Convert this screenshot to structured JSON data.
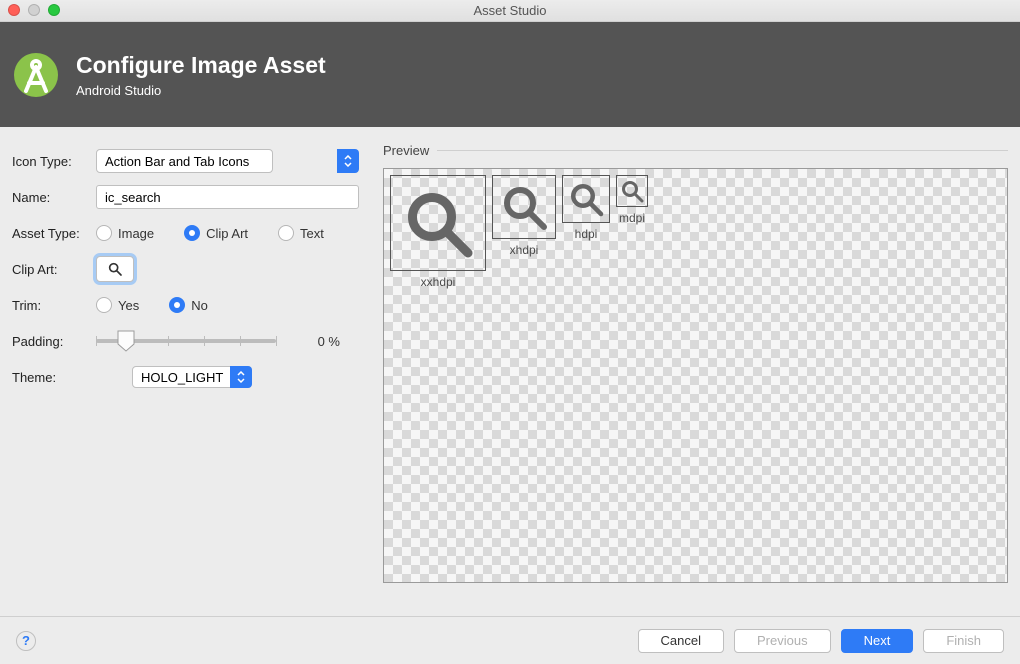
{
  "window": {
    "title": "Asset Studio"
  },
  "banner": {
    "title": "Configure Image Asset",
    "subtitle": "Android Studio"
  },
  "form": {
    "iconType": {
      "label": "Icon Type:",
      "value": "Action Bar and Tab Icons"
    },
    "name": {
      "label": "Name:",
      "value": "ic_search"
    },
    "assetType": {
      "label": "Asset Type:",
      "options": {
        "image": "Image",
        "clipart": "Clip Art",
        "text": "Text"
      },
      "selected": "clipart"
    },
    "clipArt": {
      "label": "Clip Art:"
    },
    "trim": {
      "label": "Trim:",
      "options": {
        "yes": "Yes",
        "no": "No"
      },
      "selected": "no"
    },
    "padding": {
      "label": "Padding:",
      "value": "0 %"
    },
    "theme": {
      "label": "Theme:",
      "value": "HOLO_LIGHT"
    }
  },
  "preview": {
    "label": "Preview",
    "items": [
      {
        "label": "xxhdpi",
        "size": 96
      },
      {
        "label": "xhdpi",
        "size": 64
      },
      {
        "label": "hdpi",
        "size": 48
      },
      {
        "label": "mdpi",
        "size": 32
      }
    ]
  },
  "footer": {
    "help": "?",
    "cancel": "Cancel",
    "previous": "Previous",
    "next": "Next",
    "finish": "Finish"
  }
}
